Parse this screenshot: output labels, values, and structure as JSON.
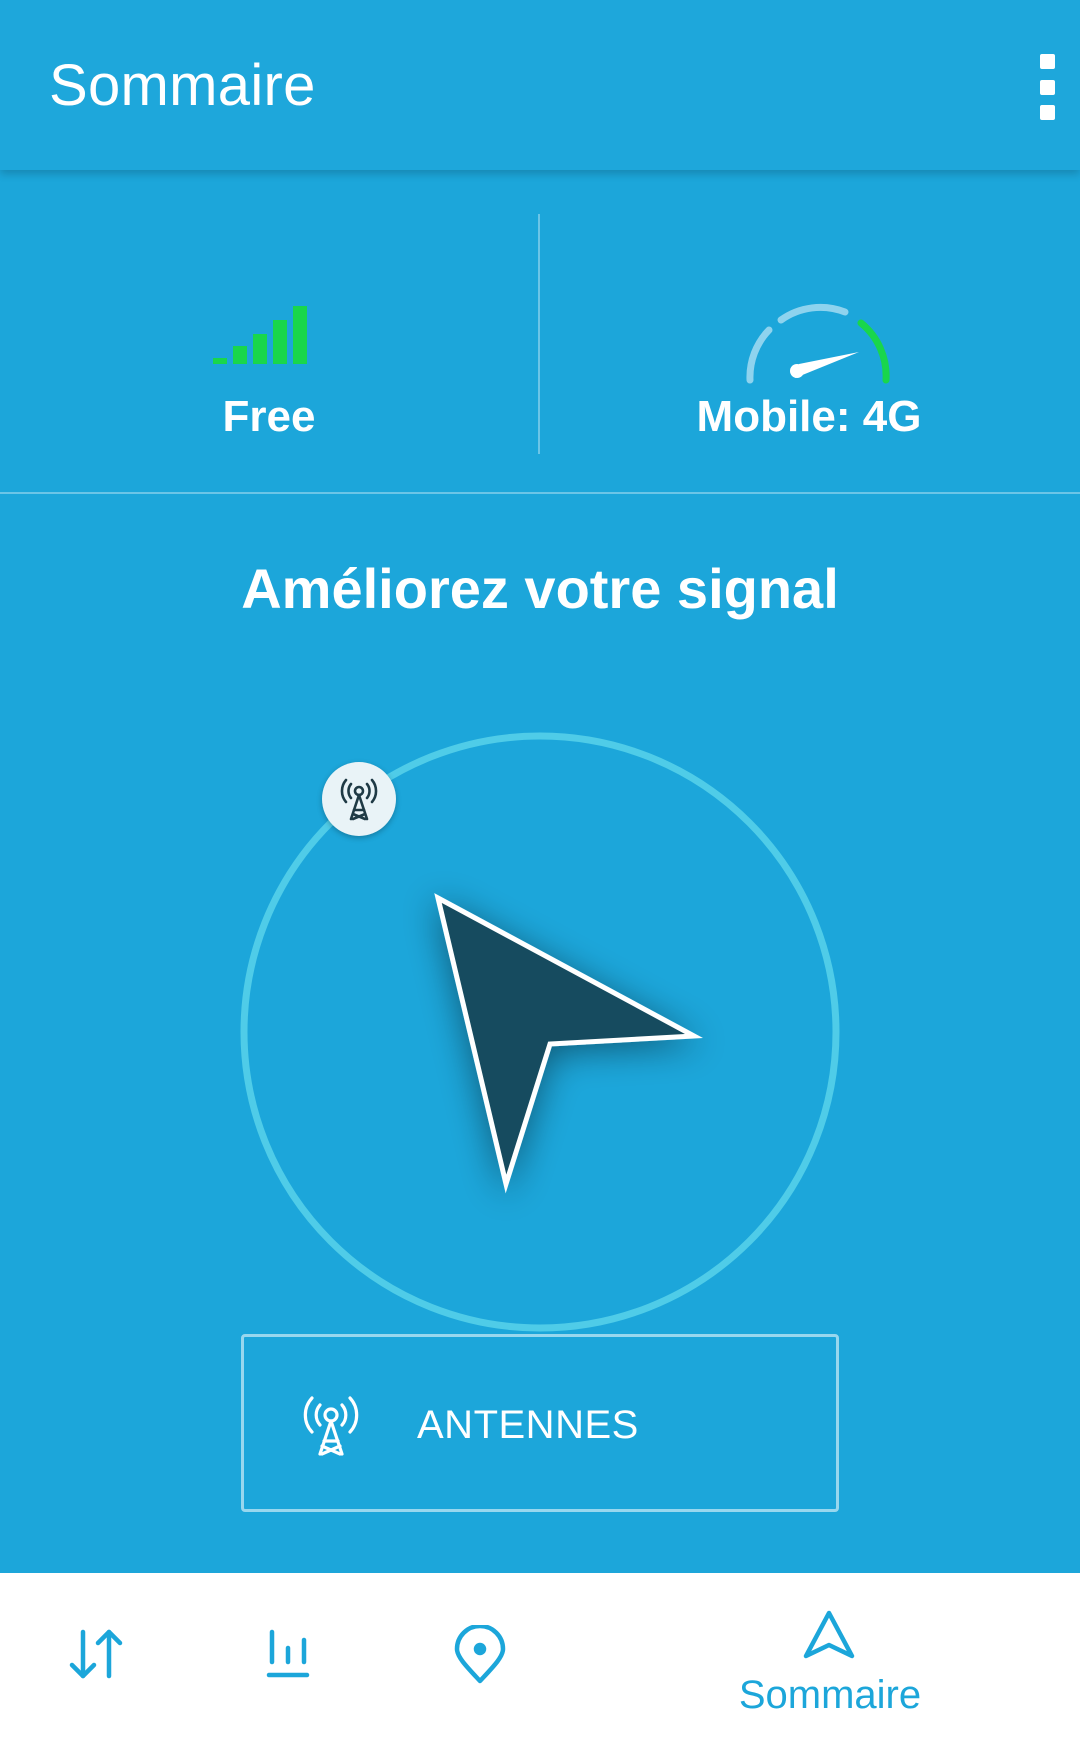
{
  "appbar": {
    "title": "Sommaire",
    "overflow_icon": "more-vert-icon"
  },
  "status": {
    "operator": {
      "label": "Free",
      "icon": "signal-bars-icon",
      "signal_level_fraction": 1.0
    },
    "network": {
      "label": "Mobile: 4G",
      "icon": "speed-gauge-icon"
    }
  },
  "main": {
    "headline": "Améliorez votre signal",
    "compass_icon": "navigation-arrow-icon",
    "tower_icon": "cell-tower-icon"
  },
  "antennes_button": {
    "label": "ANTENNES",
    "icon": "cell-tower-icon"
  },
  "bottom_nav": {
    "items": [
      {
        "icon": "transfer-arrows-icon",
        "label": ""
      },
      {
        "icon": "bar-chart-icon",
        "label": ""
      },
      {
        "icon": "map-pin-icon",
        "label": ""
      },
      {
        "icon": "navigation-outline-icon",
        "label": "Sommaire",
        "active": true
      }
    ]
  },
  "colors": {
    "primary": "#1CA6DA",
    "signal_green": "#19D64C",
    "arrow_dark": "#164B5E",
    "ring": "#4FCCE8",
    "white": "#FFFFFF"
  }
}
